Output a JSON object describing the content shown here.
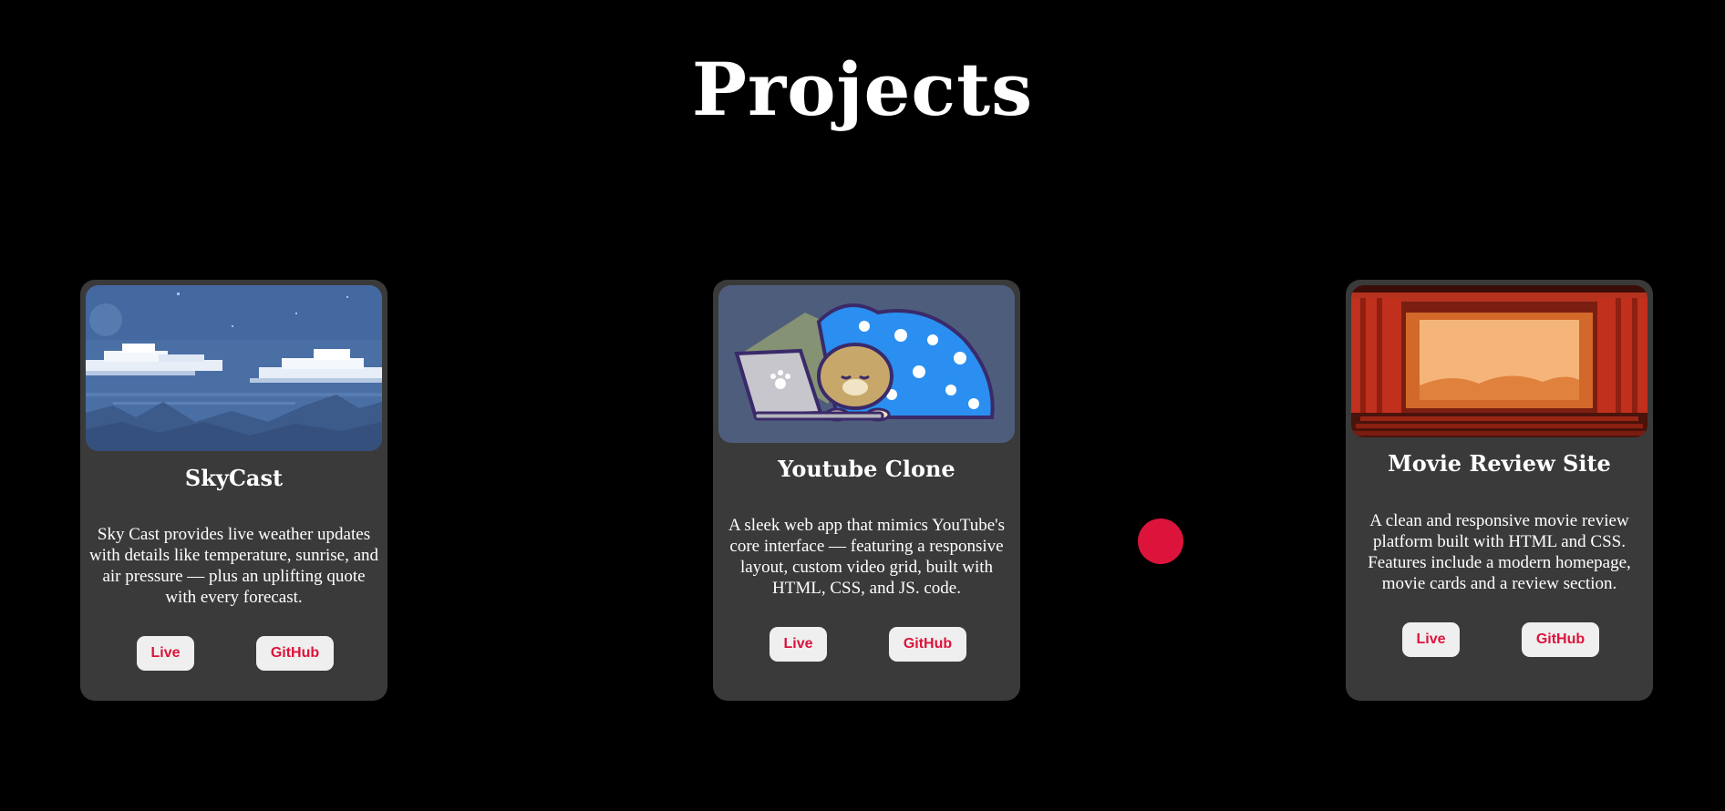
{
  "page": {
    "title": "Projects"
  },
  "colors": {
    "background": "#000000",
    "card_background": "#3a3a3a",
    "button_background": "#efefef",
    "accent": "#dc143c",
    "text": "#ffffff"
  },
  "projects": [
    {
      "title": "SkyCast",
      "description": "Sky Cast provides live weather updates with details like temperature, sunrise, and air pressure — plus an uplifting quote with every forecast.",
      "image": "pixel-art-night-sky-with-clouds",
      "live_label": "Live",
      "github_label": "GitHub"
    },
    {
      "title": "Youtube Clone",
      "description": "A sleek web app that mimics YouTube's core interface — featuring a responsive layout, custom video grid, built with HTML, CSS, and JS. code.",
      "image": "cartoon-cat-with-laptop-under-blanket",
      "live_label": "Live",
      "github_label": "GitHub"
    },
    {
      "title": "Movie Review Site",
      "description": "A clean and responsive movie review platform built with HTML and CSS. Features include a modern homepage, movie cards and a review section.",
      "image": "movie-theater-screen-with-red-curtains",
      "live_label": "Live",
      "github_label": "GitHub"
    }
  ],
  "cursor": {
    "icon": "cursor-dot-icon"
  }
}
